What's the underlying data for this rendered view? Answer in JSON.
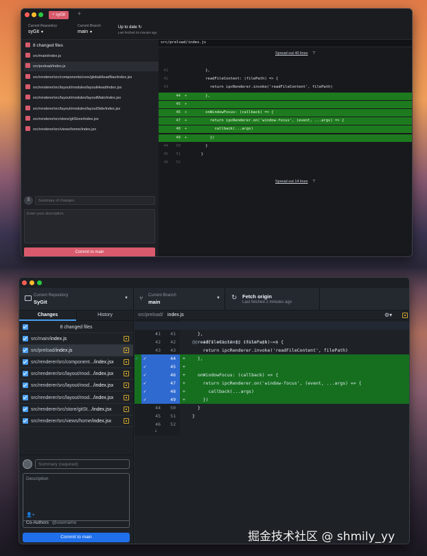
{
  "w1": {
    "tab_label": "syGit",
    "repo": {
      "label": "Current Repository",
      "value": "syGit"
    },
    "branch": {
      "label": "Current Branch",
      "value": "main"
    },
    "fetch": {
      "title": "Up to date",
      "sub": "Last fetched 24 minutes ago"
    },
    "changed_files": "8 changed files",
    "files": [
      "src/main/index.js",
      "src/preload/index.js",
      "src/renderer/src/components/core/globalHeadNav/index.jsx",
      "src/renderer/src/layout/modules/layoutHead/index.jsx",
      "src/renderer/src/layout/modules/layoutMain/index.jsx",
      "src/renderer/src/layout/modules/layoutSide/index.jsx",
      "src/renderer/src/store/gitStore/index.jsx",
      "src/renderer/src/views/home/index.jsx"
    ],
    "avatar_letter": "S",
    "summary_placeholder": "Summary of changes",
    "description_placeholder": "Enter your description",
    "commit_label": "Commit to main",
    "diff_path": "src/preload/index.js",
    "expand_top": "Spread out 40 lines",
    "expand_bottom": "Spread out 14 lines",
    "lines": [
      {
        "o": "41",
        "n": "",
        "s": "",
        "t": "    },"
      },
      {
        "o": "42",
        "n": "",
        "s": "",
        "t": "    readFileContent: (filePath) => {"
      },
      {
        "o": "43",
        "n": "",
        "s": "",
        "t": "      return ipcRenderer.invoke('readFileContent', filePath)"
      },
      {
        "o": "",
        "n": "44",
        "s": "+",
        "t": "    },",
        "add": true
      },
      {
        "o": "",
        "n": "45",
        "s": "+",
        "t": "",
        "add": true
      },
      {
        "o": "",
        "n": "46",
        "s": "+",
        "t": "    onWindowFocus: (callback) => {",
        "add": true
      },
      {
        "o": "",
        "n": "47",
        "s": "+",
        "t": "      return ipcRenderer.on('window-focus', (event, ...args) => {",
        "add": true
      },
      {
        "o": "",
        "n": "48",
        "s": "+",
        "t": "        callback(...args)",
        "add": true
      },
      {
        "o": "",
        "n": "49",
        "s": "+",
        "t": "      })",
        "add": true
      },
      {
        "o": "44",
        "n": "50",
        "s": "",
        "t": "    }"
      },
      {
        "o": "45",
        "n": "51",
        "s": "",
        "t": "  }"
      },
      {
        "o": "46",
        "n": "52",
        "s": "",
        "t": ""
      }
    ]
  },
  "w2": {
    "repo": {
      "label": "Current Repository",
      "value": "SyGit"
    },
    "branch": {
      "label": "Current Branch",
      "value": "main"
    },
    "fetch": {
      "title": "Fetch origin",
      "sub": "Last fetched 2 minutes ago"
    },
    "tabs": {
      "changes": "Changes",
      "history": "History"
    },
    "changed_files": "8 changed files",
    "files": [
      {
        "dir": "src/main/",
        "name": "index.js"
      },
      {
        "dir": "src/preload/",
        "name": "index.js"
      },
      {
        "dir": "src/renderer/src/component...",
        "name": "/index.jsx"
      },
      {
        "dir": "src/renderer/src/layout/mod...",
        "name": "/index.jsx"
      },
      {
        "dir": "src/renderer/src/layout/mod...",
        "name": "/index.jsx"
      },
      {
        "dir": "src/renderer/src/layout/mod...",
        "name": "/index.jsx"
      },
      {
        "dir": "src/renderer/src/store/gitSt...",
        "name": "/index.jsx"
      },
      {
        "dir": "src/renderer/src/views/home/",
        "name": "index.jsx"
      }
    ],
    "summary_placeholder": "Summary (required)",
    "description_placeholder": "Description",
    "coauthors": "Co-Authors",
    "coauthors_placeholder": "@username",
    "commit_label": "Commit to main",
    "diff_dir": "src/preload/",
    "diff_file": "index.js",
    "hunk_header": "@@ -41,6 +41,12 @@ const api = {",
    "lines": [
      {
        "o": "41",
        "n": "41",
        "s": "",
        "t": "  },"
      },
      {
        "o": "42",
        "n": "42",
        "s": "",
        "t": "  readFileContent: (filePath) => {"
      },
      {
        "o": "43",
        "n": "43",
        "s": "",
        "t": "    return ipcRenderer.invoke('readFileContent', filePath)"
      },
      {
        "o": "",
        "n": "44",
        "s": "+",
        "t": "  },",
        "add": true
      },
      {
        "o": "",
        "n": "45",
        "s": "+",
        "t": "",
        "add": true
      },
      {
        "o": "",
        "n": "46",
        "s": "+",
        "t": "  onWindowFocus: (callback) => {",
        "add": true
      },
      {
        "o": "",
        "n": "47",
        "s": "+",
        "t": "    return ipcRenderer.on('window-focus', (event, ...args) => {",
        "add": true
      },
      {
        "o": "",
        "n": "48",
        "s": "+",
        "t": "      callback(...args)",
        "add": true
      },
      {
        "o": "",
        "n": "49",
        "s": "+",
        "t": "    })",
        "add": true
      },
      {
        "o": "44",
        "n": "50",
        "s": "",
        "t": "  }"
      },
      {
        "o": "45",
        "n": "51",
        "s": "",
        "t": "}"
      },
      {
        "o": "46",
        "n": "52",
        "s": "",
        "t": ""
      }
    ]
  },
  "watermark": "掘金技术社区 @ shmily_yy",
  "colors": {
    "accent_pink": "#d85a6c",
    "added_green": "#1e7a1e",
    "added_green2": "#156f1f",
    "selected_blue": "#1f6feb",
    "gutter_blue": "#2f6ad0"
  }
}
